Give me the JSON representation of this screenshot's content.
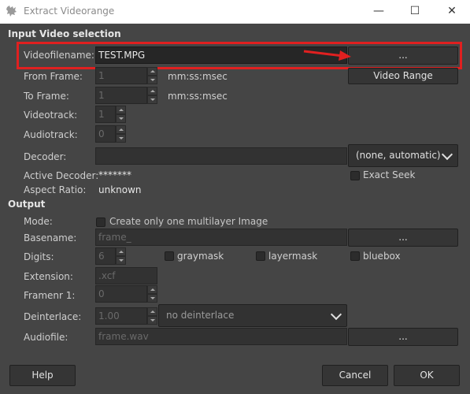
{
  "window": {
    "title": "Extract Videorange",
    "minimize_glyph": "—",
    "maximize_glyph": "☐",
    "close_glyph": "✕"
  },
  "input_section": {
    "heading": "Input Video selection",
    "videofilename_label": "Videofilename:",
    "videofilename_value": "TEST.MPG",
    "browse_label": "...",
    "from_frame_label": "From Frame:",
    "from_frame_value": "1",
    "from_frame_unit": "mm:ss:msec",
    "video_range_button": "Video Range",
    "to_frame_label": "To Frame:",
    "to_frame_value": "1",
    "to_frame_unit": "mm:ss:msec",
    "videotrack_label": "Videotrack:",
    "videotrack_value": "1",
    "audiotrack_label": "Audiotrack:",
    "audiotrack_value": "0",
    "decoder_label": "Decoder:",
    "decoder_value": "",
    "decoder_combo": "(none, automatic)",
    "active_decoder_label": "Active Decoder:",
    "active_decoder_value": "*******",
    "exact_seek_label": "Exact Seek",
    "aspect_ratio_label": "Aspect Ratio:",
    "aspect_ratio_value": "unknown"
  },
  "output_section": {
    "heading": "Output",
    "mode_label": "Mode:",
    "mode_checkbox_label": "Create only one multilayer Image",
    "basename_label": "Basename:",
    "basename_value": "frame_",
    "basename_browse": "...",
    "digits_label": "Digits:",
    "digits_value": "6",
    "graymask_label": "graymask",
    "layermask_label": "layermask",
    "bluebox_label": "bluebox",
    "extension_label": "Extension:",
    "extension_value": ".xcf",
    "framenr_label": "Framenr 1:",
    "framenr_value": "0",
    "deinterlace_label": "Deinterlace:",
    "deinterlace_value": "1.00",
    "deinterlace_combo": "no deinterlace",
    "audiofile_label": "Audiofile:",
    "audiofile_value": "frame.wav",
    "audiofile_browse": "..."
  },
  "footer": {
    "help_button": "Help",
    "cancel_button": "Cancel",
    "ok_button": "OK"
  },
  "annotation": {
    "highlight_color": "#e02020"
  }
}
